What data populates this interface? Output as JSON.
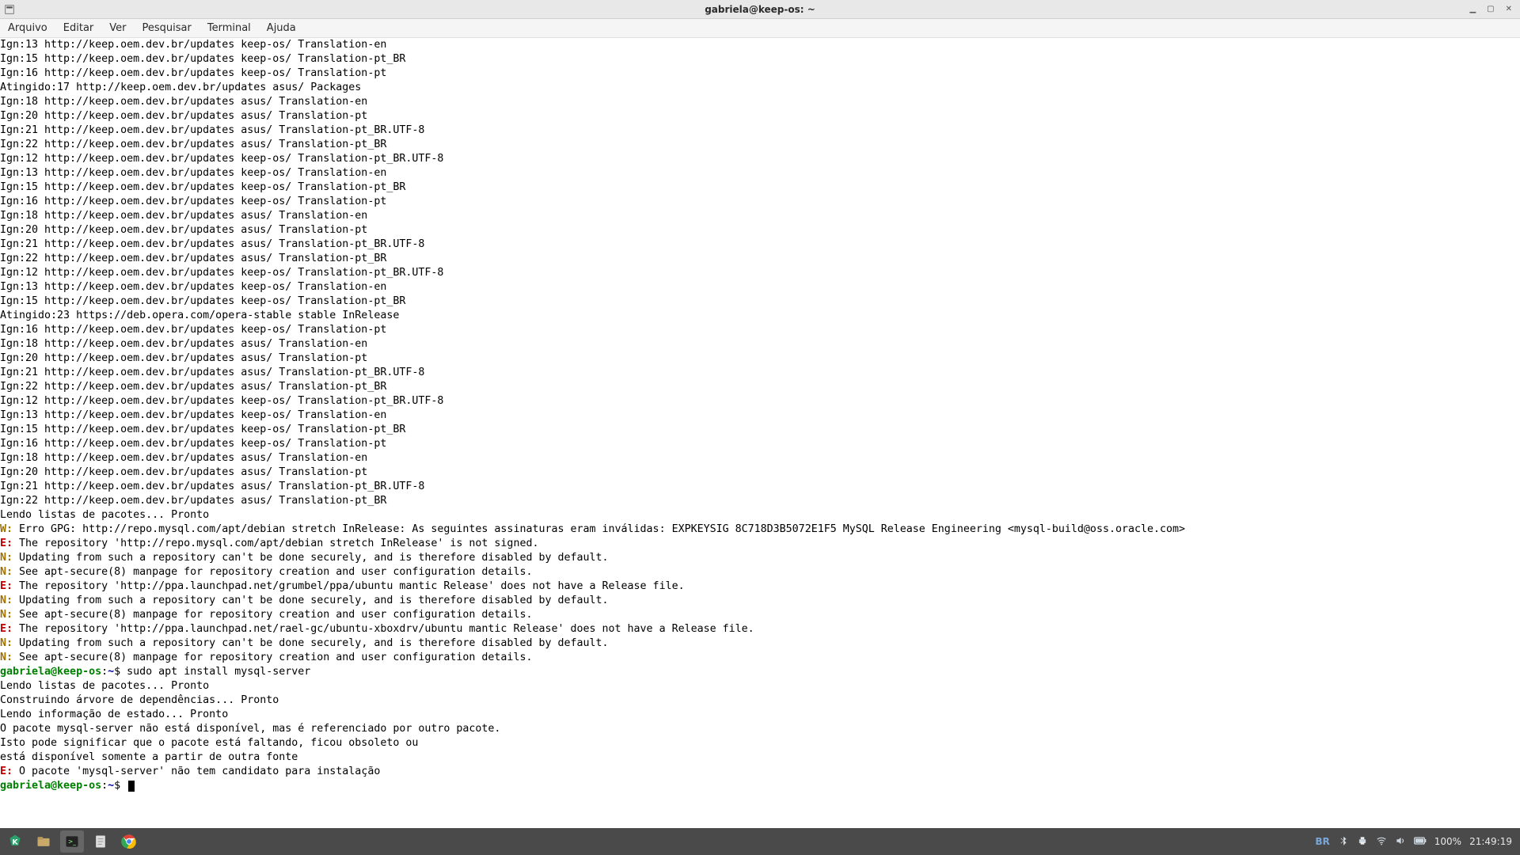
{
  "window": {
    "title": "gabriela@keep-os: ~"
  },
  "menu": {
    "items": [
      "Arquivo",
      "Editar",
      "Ver",
      "Pesquisar",
      "Terminal",
      "Ajuda"
    ]
  },
  "prompt": {
    "userhost": "gabriela@keep-os",
    "colon": ":",
    "cwd": "~",
    "dollar": "$"
  },
  "terminal_lines": [
    {
      "t": "plain",
      "text": "Ign:13 http://keep.oem.dev.br/updates keep-os/ Translation-en"
    },
    {
      "t": "plain",
      "text": "Ign:15 http://keep.oem.dev.br/updates keep-os/ Translation-pt_BR"
    },
    {
      "t": "plain",
      "text": "Ign:16 http://keep.oem.dev.br/updates keep-os/ Translation-pt"
    },
    {
      "t": "plain",
      "text": "Atingido:17 http://keep.oem.dev.br/updates asus/ Packages"
    },
    {
      "t": "plain",
      "text": "Ign:18 http://keep.oem.dev.br/updates asus/ Translation-en"
    },
    {
      "t": "plain",
      "text": "Ign:20 http://keep.oem.dev.br/updates asus/ Translation-pt"
    },
    {
      "t": "plain",
      "text": "Ign:21 http://keep.oem.dev.br/updates asus/ Translation-pt_BR.UTF-8"
    },
    {
      "t": "plain",
      "text": "Ign:22 http://keep.oem.dev.br/updates asus/ Translation-pt_BR"
    },
    {
      "t": "plain",
      "text": "Ign:12 http://keep.oem.dev.br/updates keep-os/ Translation-pt_BR.UTF-8"
    },
    {
      "t": "plain",
      "text": "Ign:13 http://keep.oem.dev.br/updates keep-os/ Translation-en"
    },
    {
      "t": "plain",
      "text": "Ign:15 http://keep.oem.dev.br/updates keep-os/ Translation-pt_BR"
    },
    {
      "t": "plain",
      "text": "Ign:16 http://keep.oem.dev.br/updates keep-os/ Translation-pt"
    },
    {
      "t": "plain",
      "text": "Ign:18 http://keep.oem.dev.br/updates asus/ Translation-en"
    },
    {
      "t": "plain",
      "text": "Ign:20 http://keep.oem.dev.br/updates asus/ Translation-pt"
    },
    {
      "t": "plain",
      "text": "Ign:21 http://keep.oem.dev.br/updates asus/ Translation-pt_BR.UTF-8"
    },
    {
      "t": "plain",
      "text": "Ign:22 http://keep.oem.dev.br/updates asus/ Translation-pt_BR"
    },
    {
      "t": "plain",
      "text": "Ign:12 http://keep.oem.dev.br/updates keep-os/ Translation-pt_BR.UTF-8"
    },
    {
      "t": "plain",
      "text": "Ign:13 http://keep.oem.dev.br/updates keep-os/ Translation-en"
    },
    {
      "t": "plain",
      "text": "Ign:15 http://keep.oem.dev.br/updates keep-os/ Translation-pt_BR"
    },
    {
      "t": "plain",
      "text": "Atingido:23 https://deb.opera.com/opera-stable stable InRelease"
    },
    {
      "t": "plain",
      "text": "Ign:16 http://keep.oem.dev.br/updates keep-os/ Translation-pt"
    },
    {
      "t": "plain",
      "text": "Ign:18 http://keep.oem.dev.br/updates asus/ Translation-en"
    },
    {
      "t": "plain",
      "text": "Ign:20 http://keep.oem.dev.br/updates asus/ Translation-pt"
    },
    {
      "t": "plain",
      "text": "Ign:21 http://keep.oem.dev.br/updates asus/ Translation-pt_BR.UTF-8"
    },
    {
      "t": "plain",
      "text": "Ign:22 http://keep.oem.dev.br/updates asus/ Translation-pt_BR"
    },
    {
      "t": "plain",
      "text": "Ign:12 http://keep.oem.dev.br/updates keep-os/ Translation-pt_BR.UTF-8"
    },
    {
      "t": "plain",
      "text": "Ign:13 http://keep.oem.dev.br/updates keep-os/ Translation-en"
    },
    {
      "t": "plain",
      "text": "Ign:15 http://keep.oem.dev.br/updates keep-os/ Translation-pt_BR"
    },
    {
      "t": "plain",
      "text": "Ign:16 http://keep.oem.dev.br/updates keep-os/ Translation-pt"
    },
    {
      "t": "plain",
      "text": "Ign:18 http://keep.oem.dev.br/updates asus/ Translation-en"
    },
    {
      "t": "plain",
      "text": "Ign:20 http://keep.oem.dev.br/updates asus/ Translation-pt"
    },
    {
      "t": "plain",
      "text": "Ign:21 http://keep.oem.dev.br/updates asus/ Translation-pt_BR.UTF-8"
    },
    {
      "t": "plain",
      "text": "Ign:22 http://keep.oem.dev.br/updates asus/ Translation-pt_BR"
    },
    {
      "t": "plain",
      "text": "Lendo listas de pacotes... Pronto"
    },
    {
      "t": "tagged",
      "tag": "W:",
      "cls": "c-yellow",
      "rest": " Erro GPG: http://repo.mysql.com/apt/debian stretch InRelease: As seguintes assinaturas eram inválidas: EXPKEYSIG 8C718D3B5072E1F5 MySQL Release Engineering <mysql-build@oss.oracle.com>"
    },
    {
      "t": "tagged",
      "tag": "E:",
      "cls": "c-red",
      "rest": " The repository 'http://repo.mysql.com/apt/debian stretch InRelease' is not signed."
    },
    {
      "t": "tagged",
      "tag": "N:",
      "cls": "c-yellow",
      "rest": " Updating from such a repository can't be done securely, and is therefore disabled by default."
    },
    {
      "t": "tagged",
      "tag": "N:",
      "cls": "c-yellow",
      "rest": " See apt-secure(8) manpage for repository creation and user configuration details."
    },
    {
      "t": "tagged",
      "tag": "E:",
      "cls": "c-red",
      "rest": " The repository 'http://ppa.launchpad.net/grumbel/ppa/ubuntu mantic Release' does not have a Release file."
    },
    {
      "t": "tagged",
      "tag": "N:",
      "cls": "c-yellow",
      "rest": " Updating from such a repository can't be done securely, and is therefore disabled by default."
    },
    {
      "t": "tagged",
      "tag": "N:",
      "cls": "c-yellow",
      "rest": " See apt-secure(8) manpage for repository creation and user configuration details."
    },
    {
      "t": "tagged",
      "tag": "E:",
      "cls": "c-red",
      "rest": " The repository 'http://ppa.launchpad.net/rael-gc/ubuntu-xboxdrv/ubuntu mantic Release' does not have a Release file."
    },
    {
      "t": "tagged",
      "tag": "N:",
      "cls": "c-yellow",
      "rest": " Updating from such a repository can't be done securely, and is therefore disabled by default."
    },
    {
      "t": "tagged",
      "tag": "N:",
      "cls": "c-yellow",
      "rest": " See apt-secure(8) manpage for repository creation and user configuration details."
    },
    {
      "t": "prompt",
      "cmd": " sudo apt install mysql-server"
    },
    {
      "t": "plain",
      "text": "Lendo listas de pacotes... Pronto"
    },
    {
      "t": "plain",
      "text": "Construindo árvore de dependências... Pronto"
    },
    {
      "t": "plain",
      "text": "Lendo informação de estado... Pronto"
    },
    {
      "t": "plain",
      "text": "O pacote mysql-server não está disponível, mas é referenciado por outro pacote."
    },
    {
      "t": "plain",
      "text": "Isto pode significar que o pacote está faltando, ficou obsoleto ou"
    },
    {
      "t": "plain",
      "text": "está disponível somente a partir de outra fonte"
    },
    {
      "t": "plain",
      "text": ""
    },
    {
      "t": "tagged",
      "tag": "E:",
      "cls": "c-red",
      "rest": " O pacote 'mysql-server' não tem candidato para instalação"
    },
    {
      "t": "prompt",
      "cmd": " ",
      "cursor": true
    }
  ],
  "taskbar": {
    "battery": "100%",
    "clock": "21:49:19",
    "lang": "BR"
  },
  "colors": {
    "prompt_userhost": "#008000",
    "prompt_cwd": "#0000aa",
    "error": "#c00000",
    "warn": "#a07000"
  }
}
